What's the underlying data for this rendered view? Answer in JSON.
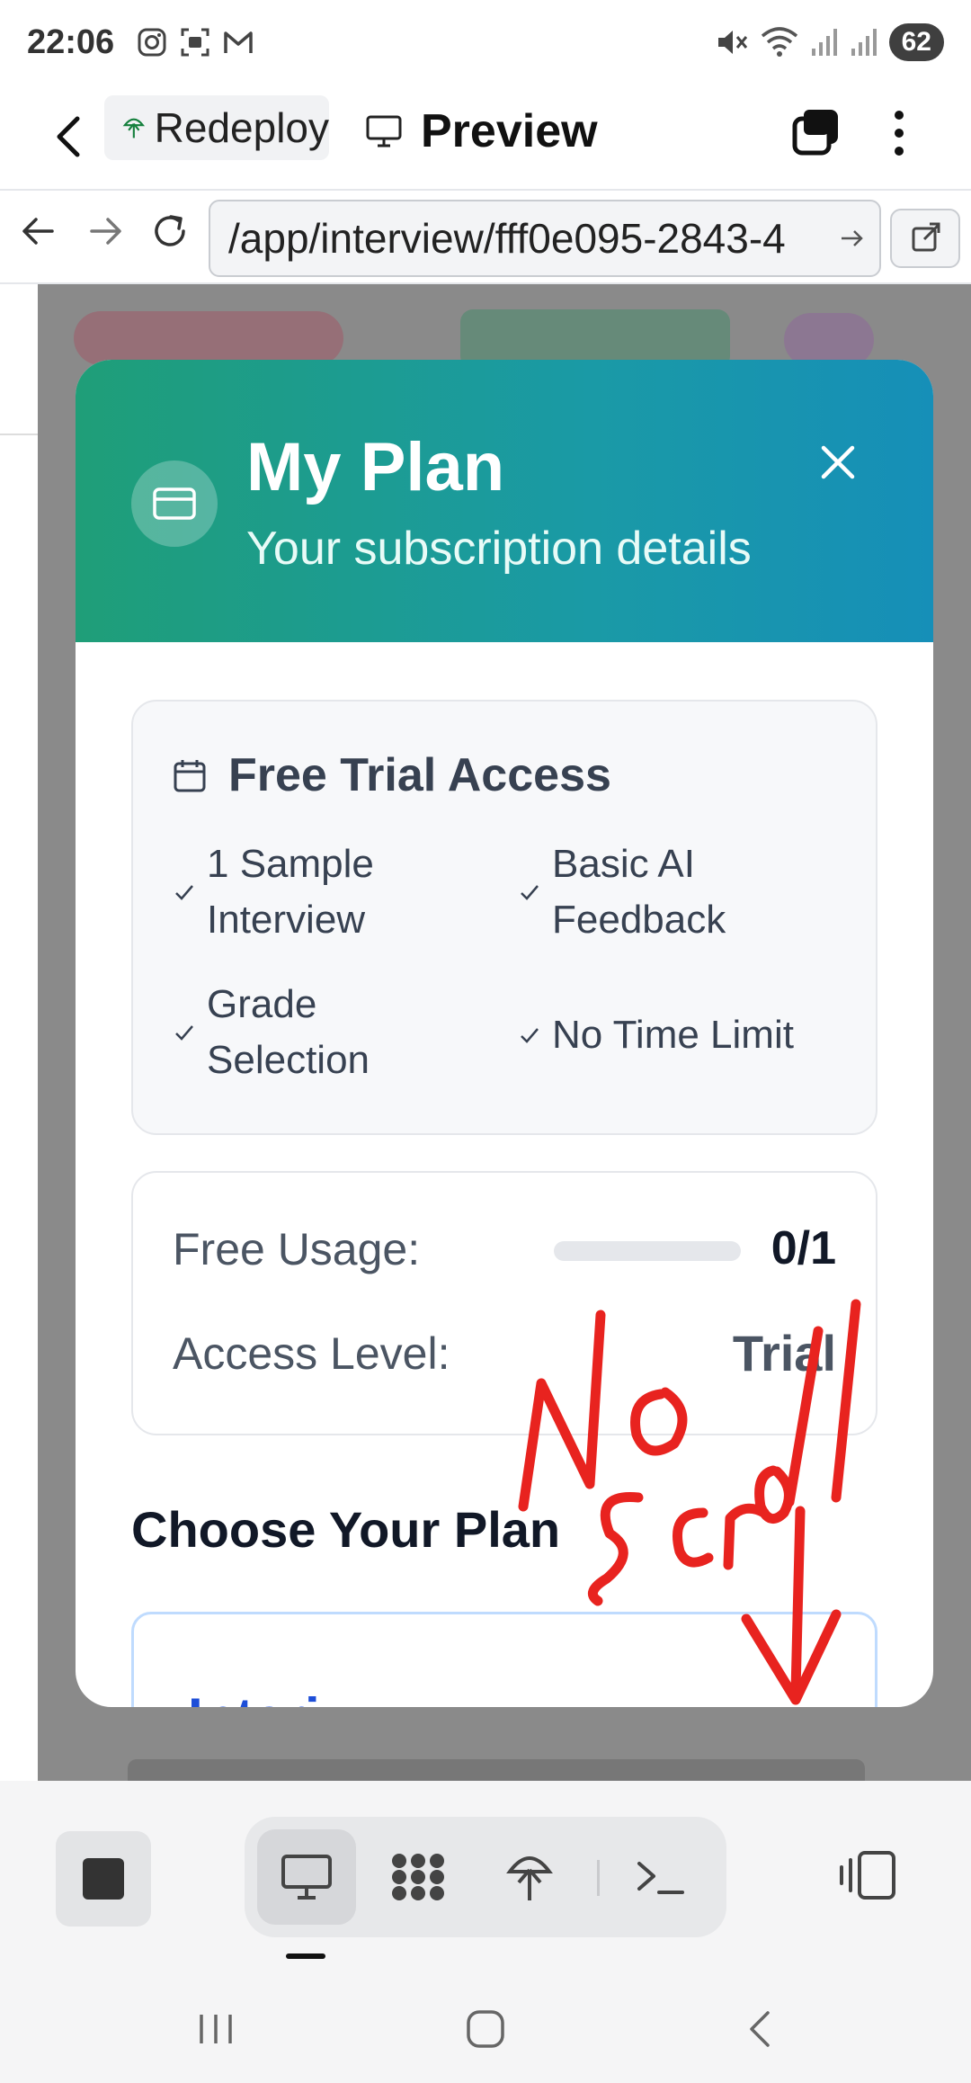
{
  "status_bar": {
    "time": "22:06",
    "battery": "62",
    "icons": [
      "instagram-icon",
      "screenshot-icon",
      "gmail-icon",
      "mute-icon",
      "wifi-icon",
      "signal-icon",
      "signal-icon"
    ]
  },
  "tabs": {
    "redeploy_label": "Redeploy",
    "preview_label": "Preview"
  },
  "address_bar": {
    "url": "/app/interview/fff0e095-2843-4"
  },
  "modal": {
    "title": "My Plan",
    "subtitle": "Your subscription details",
    "trial_card": {
      "title": "Free Trial Access",
      "features": [
        "1 Sample Interview",
        "Basic AI Feedback",
        "Grade Selection",
        "No Time Limit"
      ]
    },
    "usage_card": {
      "usage_label": "Free Usage:",
      "usage_value": "0/1",
      "usage_fraction": 0,
      "access_label": "Access Level:",
      "access_value": "Trial"
    },
    "choose_heading": "Choose Your Plan",
    "plan_card_partial_text": "Interi"
  },
  "annotation": {
    "text": "No scroll",
    "color": "#e8231f"
  },
  "colors": {
    "header_gradient_start": "#1f9e78",
    "header_gradient_end": "#168fb8",
    "plan_border": "#bfdbfe"
  }
}
